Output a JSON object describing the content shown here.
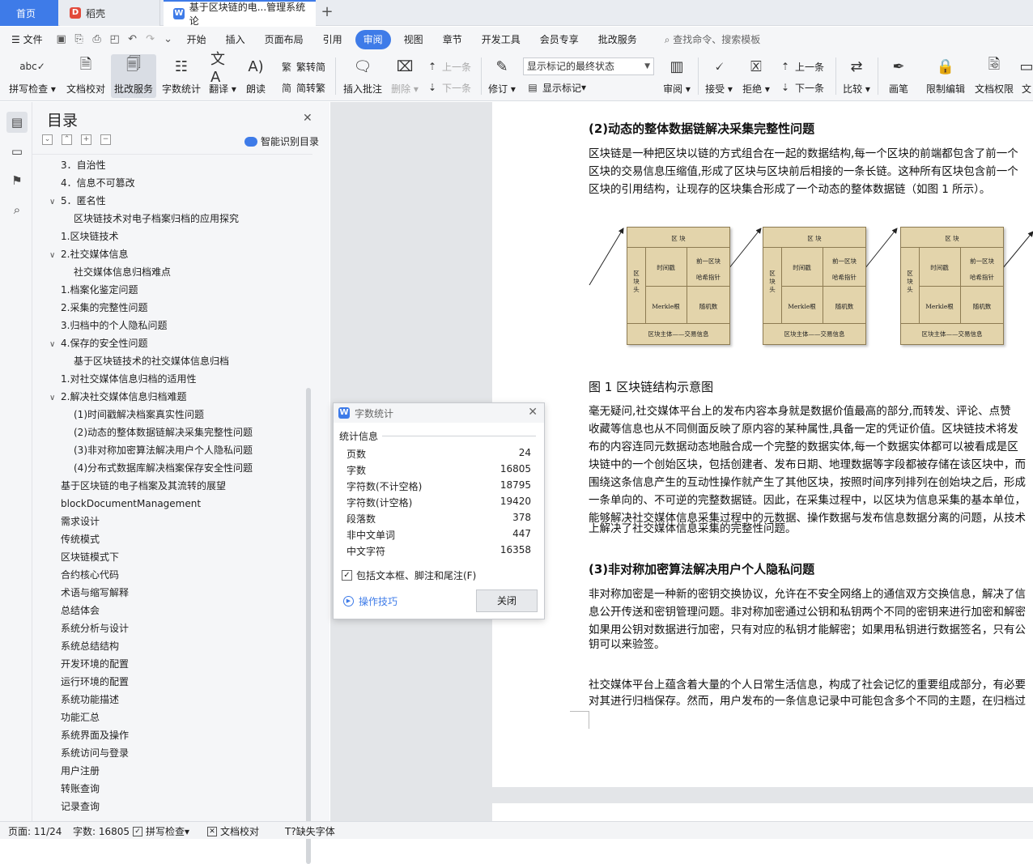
{
  "tabs": {
    "home": "首页",
    "daoke": "稻壳",
    "doc": "基于区块链的电...管理系统 论"
  },
  "menu": {
    "file": "文件",
    "items": [
      "开始",
      "插入",
      "页面布局",
      "引用",
      "审阅",
      "视图",
      "章节",
      "开发工具",
      "会员专享",
      "批改服务"
    ],
    "search": "查找命令、搜索模板"
  },
  "ribbon": {
    "spell": "拼写检查",
    "proofread": "文档校对",
    "correction": "批改服务",
    "wordcount": "字数统计",
    "translate": "翻译",
    "read": "朗读",
    "to_trad": "繁转简",
    "to_simp": "简转繁",
    "insert_comment": "插入批注",
    "delete": "删除",
    "prev": "上一条",
    "next": "下一条",
    "revise": "修订",
    "markup_select": "显示标记的最终状态",
    "show_markup": "显示标记",
    "review": "审阅",
    "accept": "接受",
    "reject": "拒绝",
    "prev2": "上一条",
    "next2": "下一条",
    "compare": "比较",
    "pen": "画笔",
    "restrict": "限制编辑",
    "rights": "文档权限",
    "more": "文"
  },
  "toc": {
    "title": "目录",
    "smart": "智能识别目录",
    "items": [
      "3．自治性",
      "4．信息不可篡改",
      "5．匿名性",
      "区块链技术对电子档案归档的应用探究",
      "1.区块链技术",
      "2.社交媒体信息",
      "社交媒体信息归档难点",
      "1.档案化鉴定问题",
      "2.采集的完整性问题",
      "3.归档中的个人隐私问题",
      "4.保存的安全性问题",
      "基于区块链技术的社交媒体信息归档",
      "1.对社交媒体信息归档的适用性",
      "2.解决社交媒体信息归档难题",
      "(1)时间戳解决档案真实性问题",
      "(2)动态的整体数据链解决采集完整性问题",
      "(3)非对称加密算法解决用户个人隐私问题",
      "(4)分布式数据库解决档案保存安全性问题",
      "基于区块链的电子档案及其流转的展望",
      "blockDocumentManagement",
      "需求设计",
      "传统模式",
      "区块链模式下",
      "合约核心代码",
      "术语与缩写解释",
      "总结体会",
      "系统分析与设计",
      "系统总结结构",
      "开发环境的配置",
      "运行环境的配置",
      "系统功能描述",
      "功能汇总",
      "系统界面及操作",
      "系统访问与登录",
      "用户注册",
      "转账查询",
      "记录查询"
    ]
  },
  "document": {
    "h2_1": "(2)动态的整体数据链解决采集完整性问题",
    "p1": [
      "区块链是一种把区块以链的方式组合在一起的数据结构,每一个区块的前端都包含了前一个",
      "区块的交易信息压缩值,形成了区块与区块前后相接的一条长链。这种所有区块包含前一个",
      "区块的引用结构，让现存的区块集合形成了一个动态的整体数据链（如图 1 所示）。"
    ],
    "block": {
      "top": "区 块",
      "head": "区块头",
      "time": "时间戳",
      "prev1": "前一区块",
      "prev2": "哈希指针",
      "merkle": "Merkle根",
      "nonce": "随机数",
      "body": "区块主体——交易信息"
    },
    "caption": "图 1  区块链结构示意图",
    "p2": [
      "毫无疑问,社交媒体平台上的发布内容本身就是数据价值最高的部分,而转发、评论、点赞",
      "收藏等信息也从不同侧面反映了原内容的某种属性,具备一定的凭证价值。区块链技术将发",
      "布的内容连同元数据动态地融合成一个完整的数据实体,每一个数据实体都可以被看成是区",
      "块链中的一个创始区块，包括创建者、发布日期、地理数据等字段都被存储在该区块中，而",
      "围绕这条信息产生的互动性操作就产生了其他区块，按照时间序列排列在创始块之后，形成",
      "一条单向的、不可逆的完整数据链。因此，在采集过程中，以区块为信息采集的基本单位，",
      "能够解决社交媒体信息采集过程中的元数据、操作数据与发布信息数据分离的问题，从技术",
      "上解决了社交媒体信息采集的完整性问题。"
    ],
    "h2_2": "(3)非对称加密算法解决用户个人隐私问题",
    "p3": [
      "非对称加密是一种新的密钥交换协议，允许在不安全网络上的通信双方交换信息，解决了信",
      "息公开传送和密钥管理问题。非对称加密通过公钥和私钥两个不同的密钥来进行加密和解密",
      "如果用公钥对数据进行加密，只有对应的私钥才能解密；如果用私钥进行数据签名，只有公",
      "钥可以来验签。"
    ],
    "p4": [
      "社交媒体平台上蕴含着大量的个人日常生活信息，构成了社会记忆的重要组成部分，有必要",
      "对其进行归档保存。然而，用户发布的一条信息记录中可能包含多个不同的主题，在归档过"
    ]
  },
  "dialog": {
    "title": "字数统计",
    "section": "统计信息",
    "rows": [
      {
        "label": "页数",
        "value": "24"
      },
      {
        "label": "字数",
        "value": "16805"
      },
      {
        "label": "字符数(不计空格)",
        "value": "18795"
      },
      {
        "label": "字符数(计空格)",
        "value": "19420"
      },
      {
        "label": "段落数",
        "value": "378"
      },
      {
        "label": "非中文单词",
        "value": "447"
      },
      {
        "label": "中文字符",
        "value": "16358"
      }
    ],
    "include": "包括文本框、脚注和尾注(F)",
    "tips": "操作技巧",
    "close": "关闭"
  },
  "status": {
    "page": "页面: 11/24",
    "words": "字数: 16805",
    "spell": "拼写检查",
    "proof": "文档校对",
    "font": "缺失字体"
  }
}
